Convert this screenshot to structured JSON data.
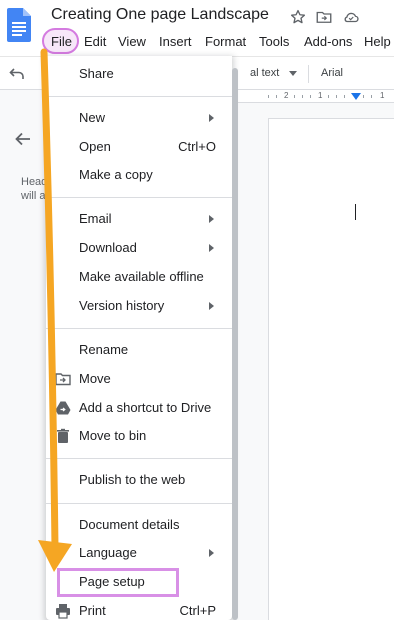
{
  "header": {
    "title": "Creating One page Landscape",
    "icons": [
      "star-icon",
      "move-to-folder-icon",
      "cloud-saved-icon"
    ]
  },
  "menubar": {
    "items": [
      "File",
      "Edit",
      "View",
      "Insert",
      "Format",
      "Tools",
      "Add-ons",
      "Help"
    ]
  },
  "toolbar": {
    "style_text": "al text",
    "font_text": "Arial"
  },
  "ruler": {
    "numbers": [
      "2",
      "1",
      "1"
    ]
  },
  "outline_panel": {
    "hint_line1": "Head",
    "hint_line2": "will a"
  },
  "file_menu": {
    "items": [
      {
        "label": "Share"
      },
      {
        "label": "New",
        "submenu": true
      },
      {
        "label": "Open",
        "shortcut": "Ctrl+O"
      },
      {
        "label": "Make a copy"
      },
      {
        "label": "Email",
        "submenu": true
      },
      {
        "label": "Download",
        "submenu": true
      },
      {
        "label": "Make available offline"
      },
      {
        "label": "Version history",
        "submenu": true
      },
      {
        "label": "Rename"
      },
      {
        "label": "Move",
        "icon": "move-folder-icon"
      },
      {
        "label": "Add a shortcut to Drive",
        "icon": "drive-shortcut-icon"
      },
      {
        "label": "Move to bin",
        "icon": "trash-icon"
      },
      {
        "label": "Publish to the web"
      },
      {
        "label": "Document details"
      },
      {
        "label": "Language",
        "submenu": true
      },
      {
        "label": "Page setup"
      },
      {
        "label": "Print",
        "shortcut": "Ctrl+P",
        "icon": "print-icon"
      }
    ]
  },
  "colors": {
    "highlight": "#d47be0",
    "arrow": "#f5a623",
    "accent": "#1a73e8",
    "docs_blue": "#4285f4"
  }
}
